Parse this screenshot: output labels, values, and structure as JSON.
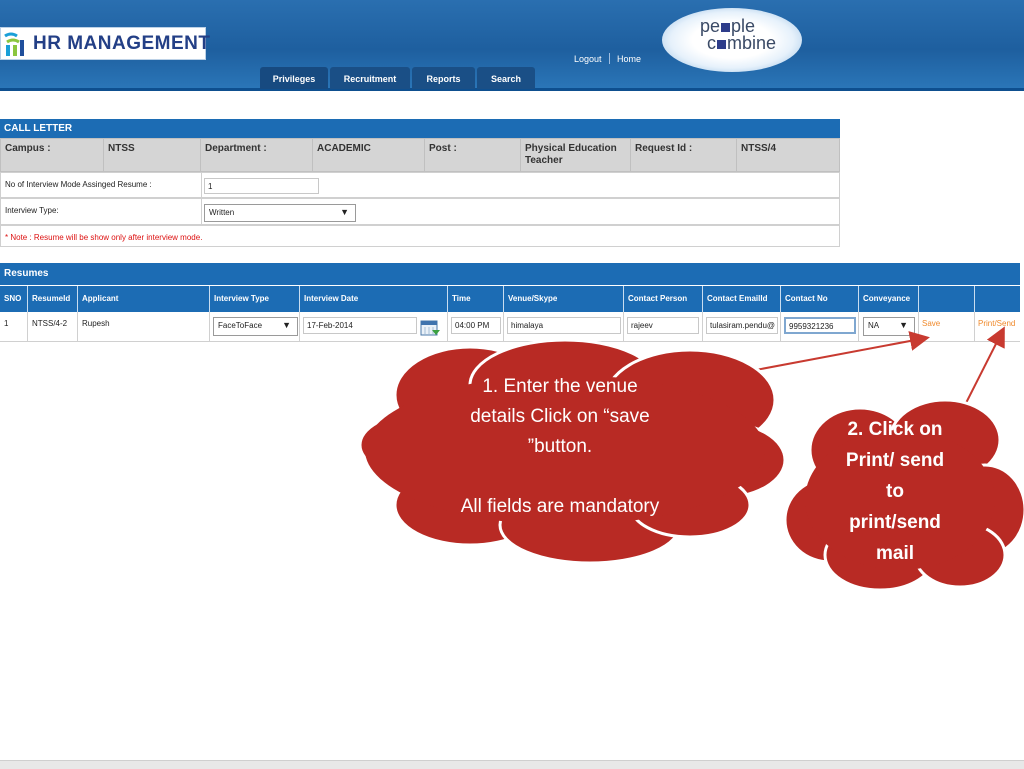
{
  "app": {
    "title": "HR MANAGEMENT",
    "brand_line1": "pe",
    "brand_line1b": "ple",
    "brand_line2a": "c",
    "brand_line2b": "mbine"
  },
  "header": {
    "links": [
      "Logout",
      "Home"
    ]
  },
  "nav": {
    "tabs": [
      "Privileges",
      "Recruitment",
      "Reports",
      "Search"
    ]
  },
  "call_letter": {
    "title": "CALL LETTER",
    "campus_label": "Campus :",
    "campus_value": "NTSS",
    "department_label": "Department :",
    "department_value": "ACADEMIC",
    "post_label": "Post :",
    "post_value": "Physical Education Teacher",
    "request_label": "Request Id :",
    "request_value": "NTSS/4",
    "mode_count_label": "No of Interview Mode Assinged Resume :",
    "mode_count_value": "1",
    "interview_type_label": "Interview Type:",
    "interview_type_value": "Written",
    "note": "* Note : Resume will be show only after interview mode."
  },
  "resumes": {
    "title": "Resumes",
    "columns": [
      "SNO",
      "ResumeId",
      "Applicant",
      "Interview Type",
      "Interview Date",
      "Time",
      "Venue/Skype",
      "Contact Person",
      "Contact EmailId",
      "Contact No",
      "Conveyance",
      "",
      ""
    ],
    "row": {
      "sno": "1",
      "resume_id": "NTSS/4-2",
      "applicant": "Rupesh",
      "interview_type": "FaceToFace",
      "interview_date": "17-Feb-2014",
      "time": "04:00 PM",
      "venue": "himalaya",
      "contact_person": "rajeev",
      "email": "tulasiram.pendu@",
      "contact_no": "9959321236",
      "conveyance": "NA",
      "save_label": "Save",
      "print_label": "Print/Send"
    }
  },
  "callouts": {
    "c1_line1": "1. Enter the venue",
    "c1_line2": "details Click on “save",
    "c1_line3": "”button.",
    "c1_line4": "All fields are mandatory",
    "c2_line1": "2.  Click on",
    "c2_line2": "Print/ send",
    "c2_line3": "to",
    "c2_line4": "print/send",
    "c2_line5": "mail"
  },
  "colors": {
    "header": "#1e5f9f",
    "section": "#1c6cb4",
    "cloud": "#b82a24",
    "arrow": "#c83a30",
    "link": "#f08a2c"
  }
}
